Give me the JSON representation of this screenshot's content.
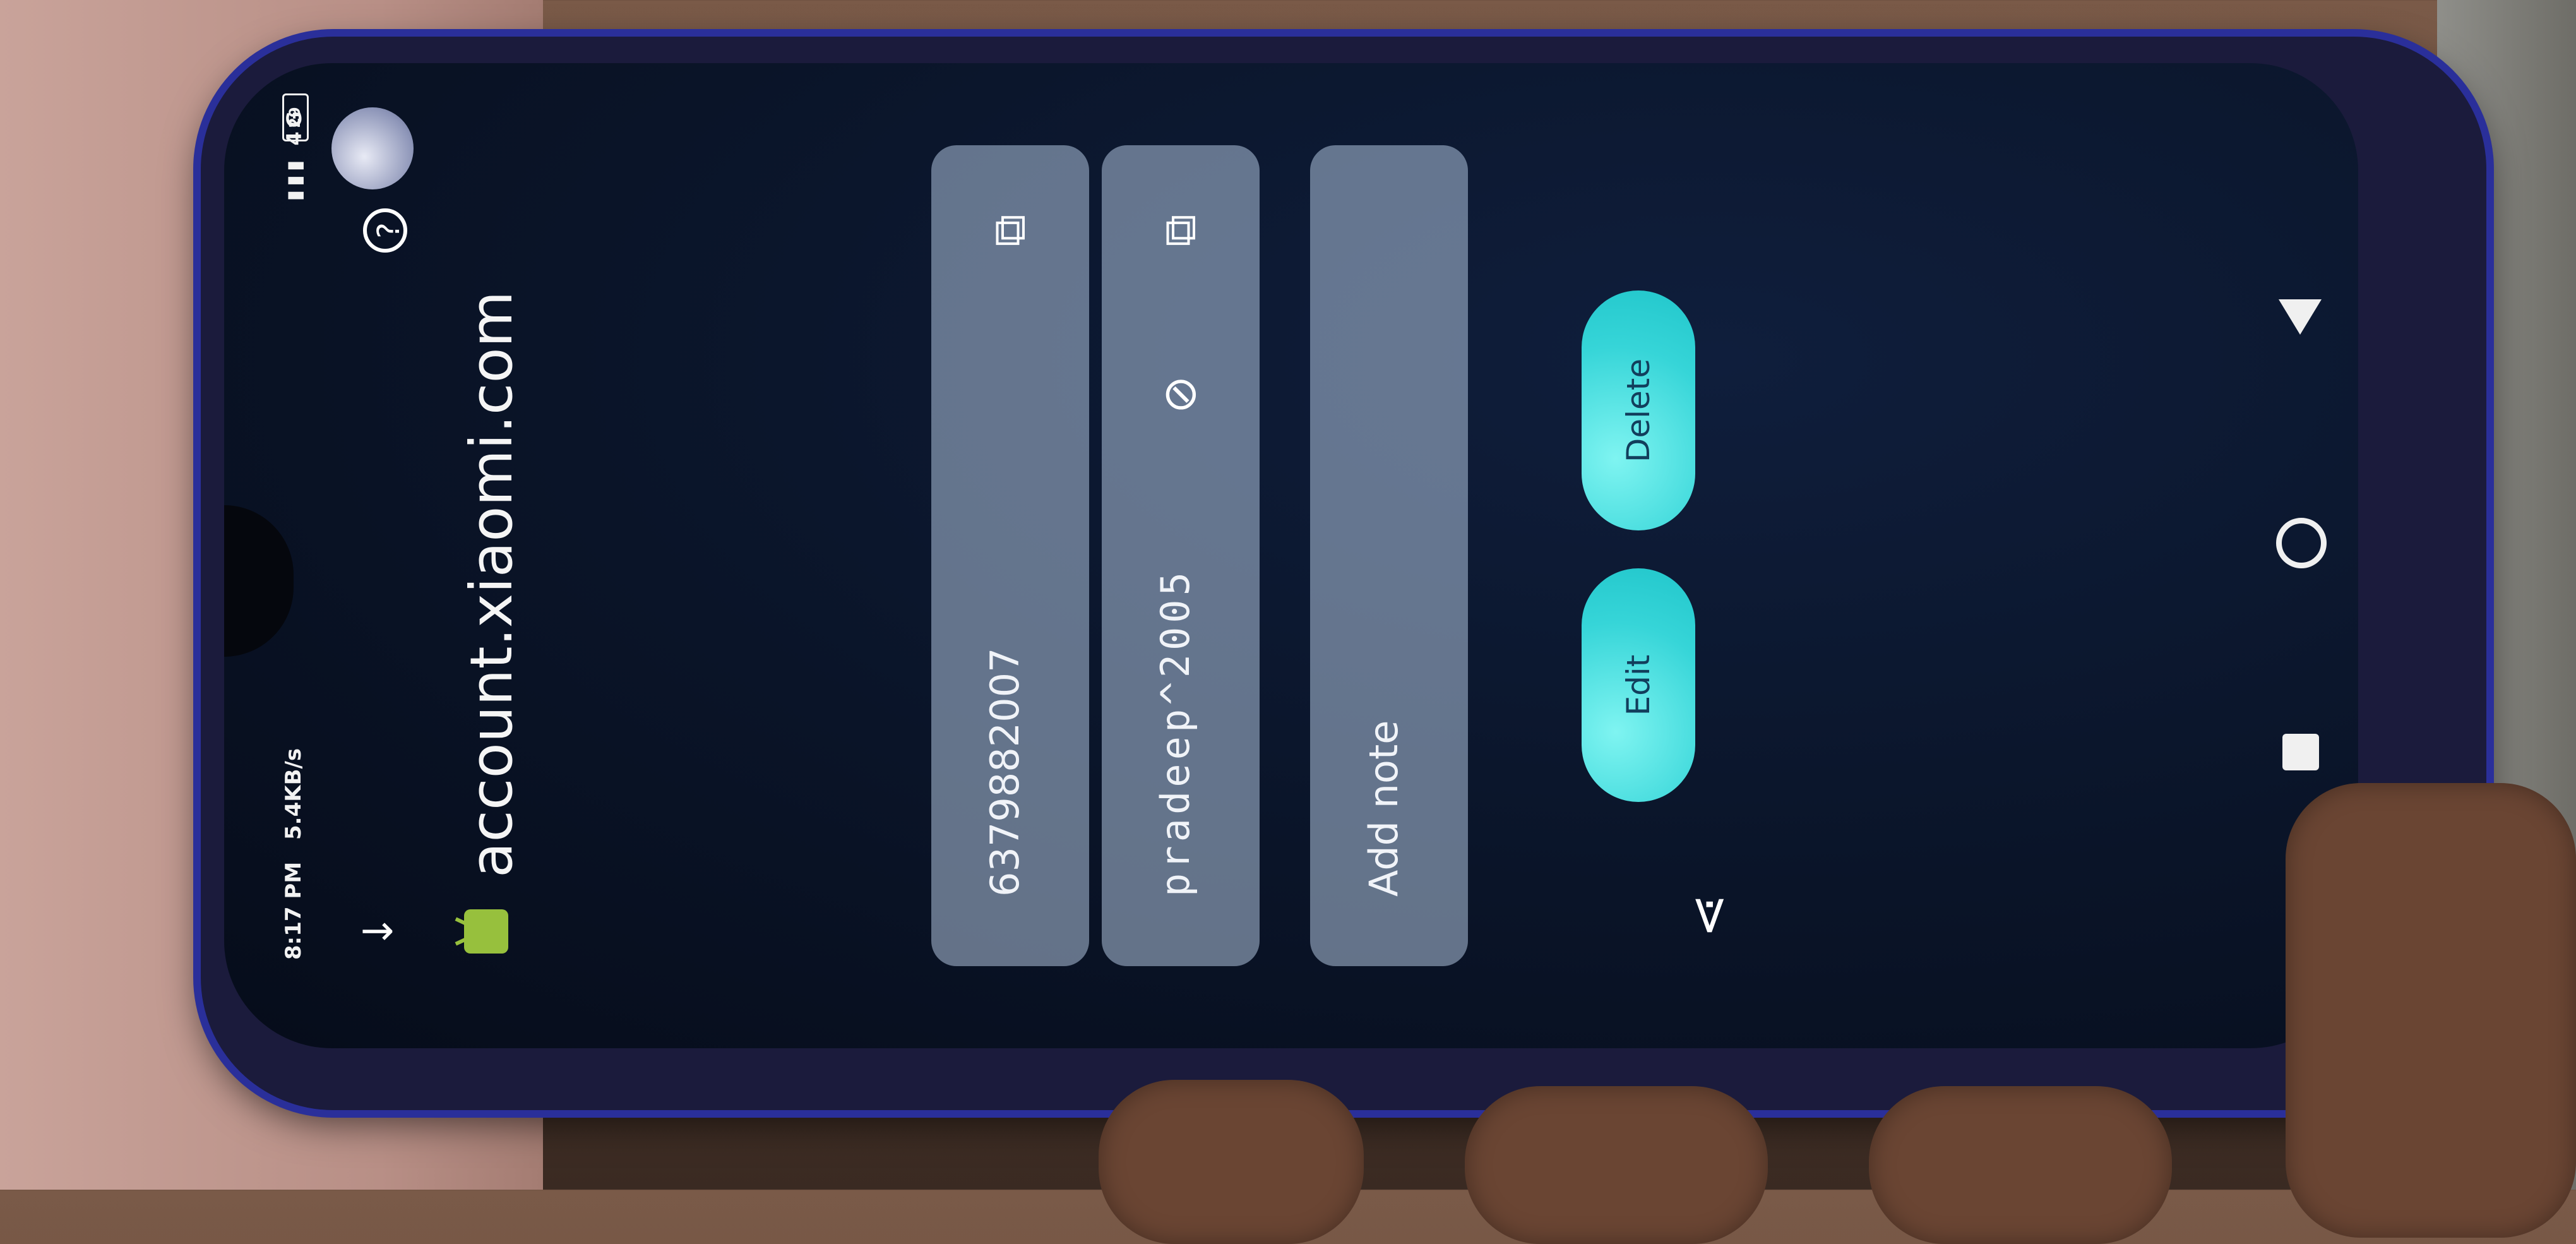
{
  "status_bar": {
    "time": "8:17 PM",
    "network_speed": "5.4KB/s",
    "signal_icons": "4G",
    "battery": "29"
  },
  "app_bar": {
    "back_icon": "arrow-back-icon",
    "help_icon": "help-icon",
    "avatar": "account-avatar"
  },
  "entry": {
    "site": "account.xiaomi.com",
    "app_icon": "android-icon"
  },
  "fields": {
    "username": {
      "value": "6379882007",
      "copy_icon": "copy-icon"
    },
    "password": {
      "value": "pradeep^2005",
      "copy_icon": "copy-icon",
      "visibility_icon": "visibility-off-icon"
    },
    "note": {
      "placeholder": "Add note"
    }
  },
  "actions": {
    "share_icon": "share-icon",
    "edit_label": "Edit",
    "delete_label": "Delete"
  },
  "system_nav": {
    "recents": "square-icon",
    "home": "circle-icon",
    "back": "triangle-back-icon"
  },
  "colors": {
    "accent_pill": "#36d5d8",
    "field_bg": "#afc3dc",
    "screen_bg": "#0a1428"
  }
}
